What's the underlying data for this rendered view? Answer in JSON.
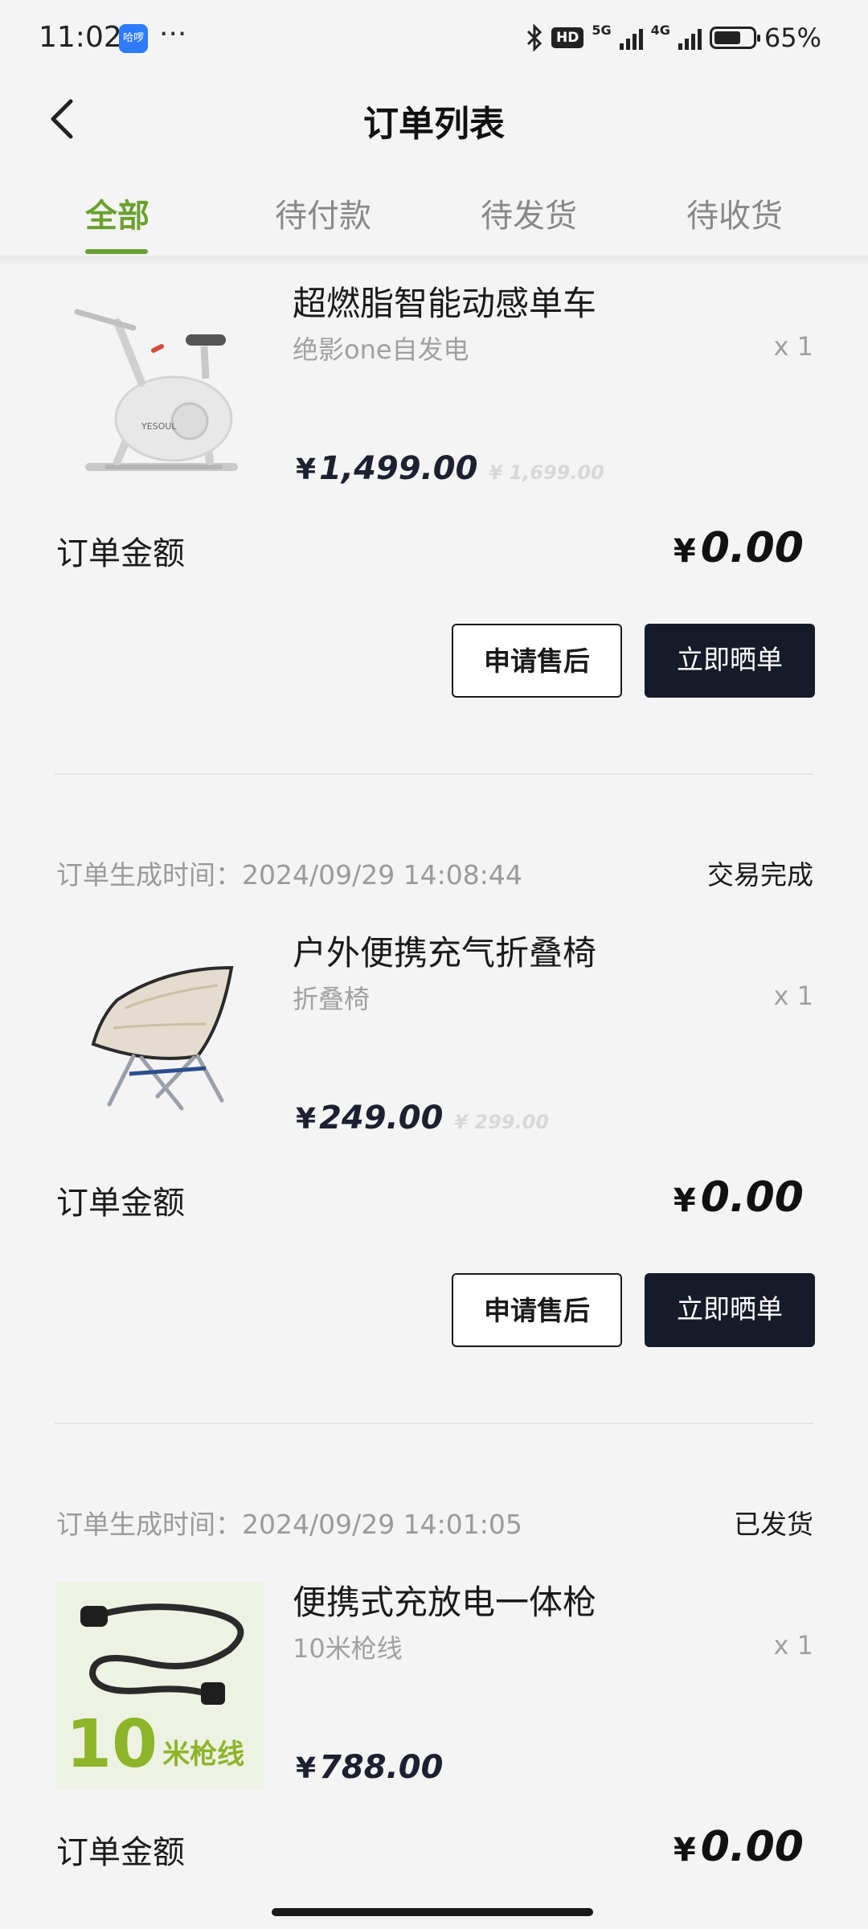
{
  "status_bar": {
    "time": "11:02",
    "app_badge": "哈啰",
    "more": "···",
    "net_5g": "5G",
    "net_4g": "4G",
    "hd": "HD",
    "battery": "65%"
  },
  "header": {
    "title": "订单列表"
  },
  "tabs": [
    {
      "label": "全部",
      "active": true
    },
    {
      "label": "待付款",
      "active": false
    },
    {
      "label": "待发货",
      "active": false
    },
    {
      "label": "待收货",
      "active": false
    }
  ],
  "orders": [
    {
      "product_name": "超燃脂智能动感单车",
      "spec": "绝影one自发电",
      "qty": "x 1",
      "yen": "¥",
      "price": "1,499.00",
      "original_price": "¥ 1,699.00",
      "amount_label": "订单金额",
      "amount": "0.00",
      "btn_after_sale": "申请售后",
      "btn_review": "立即晒单"
    },
    {
      "time_label": "订单生成时间：2024/09/29 14:08:44",
      "status": "交易完成",
      "product_name": "户外便携充气折叠椅",
      "spec": "折叠椅",
      "qty": "x 1",
      "yen": "¥",
      "price": "249.00",
      "original_price": "¥ 299.00",
      "amount_label": "订单金额",
      "amount": "0.00",
      "btn_after_sale": "申请售后",
      "btn_review": "立即晒单"
    },
    {
      "time_label": "订单生成时间：2024/09/29 14:01:05",
      "status": "已发货",
      "product_name": "便携式充放电一体枪",
      "spec": "10米枪线",
      "qty": "x 1",
      "yen": "¥",
      "price": "788.00",
      "amount_label": "订单金额",
      "amount": "0.00",
      "image_text_number": "10",
      "image_text_label": "米枪线"
    }
  ],
  "colors": {
    "accent": "#6ba02e",
    "dark_button": "#161b29",
    "background": "#f4f4f4"
  }
}
